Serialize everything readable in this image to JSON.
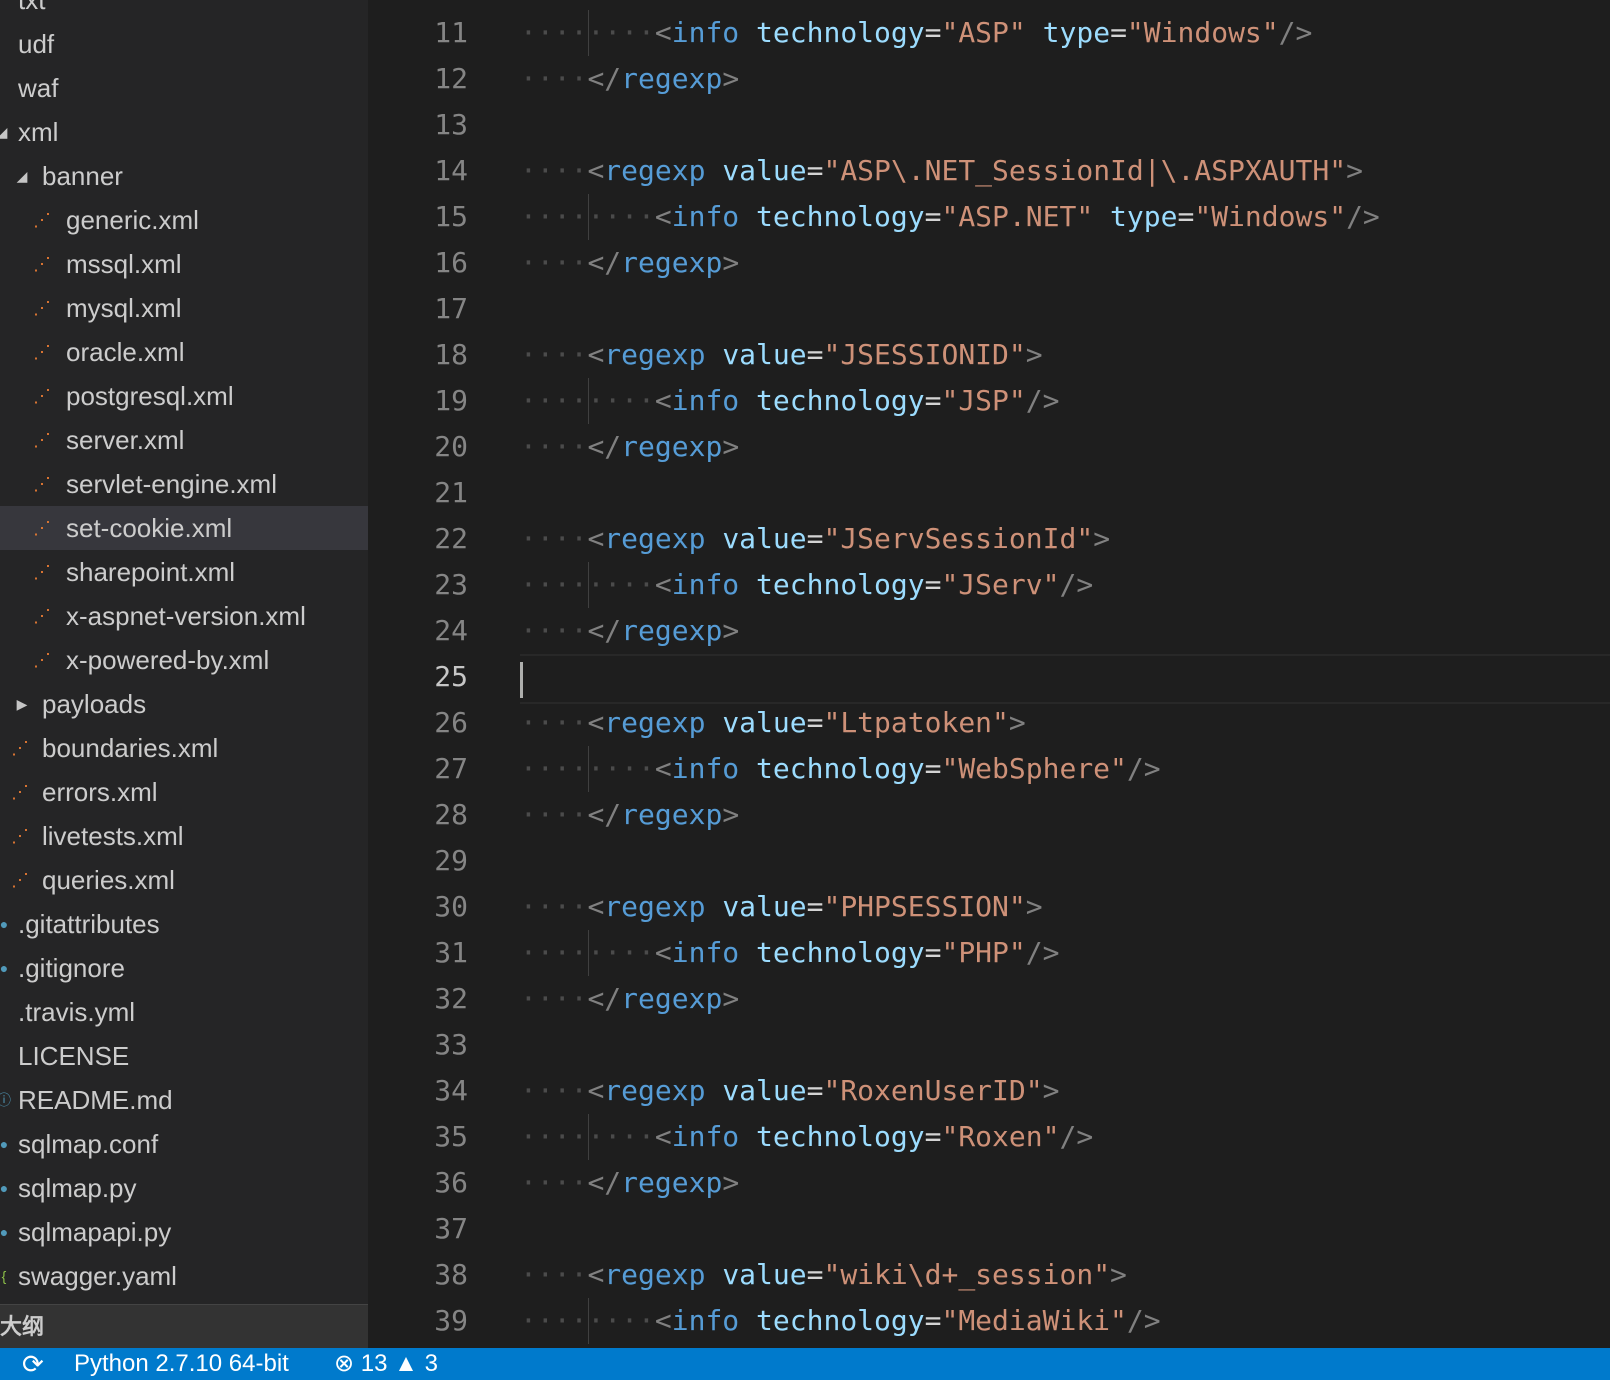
{
  "sidebar": {
    "tree": [
      {
        "label": "txt",
        "indent": 0,
        "icon": "none"
      },
      {
        "label": "udf",
        "indent": 0,
        "icon": "none"
      },
      {
        "label": "waf",
        "indent": 0,
        "icon": "none"
      },
      {
        "label": "xml",
        "indent": 0,
        "icon": "chevron-down"
      },
      {
        "label": "banner",
        "indent": 1,
        "icon": "chevron-down"
      },
      {
        "label": "generic.xml",
        "indent": 2,
        "icon": "rss"
      },
      {
        "label": "mssql.xml",
        "indent": 2,
        "icon": "rss"
      },
      {
        "label": "mysql.xml",
        "indent": 2,
        "icon": "rss"
      },
      {
        "label": "oracle.xml",
        "indent": 2,
        "icon": "rss"
      },
      {
        "label": "postgresql.xml",
        "indent": 2,
        "icon": "rss"
      },
      {
        "label": "server.xml",
        "indent": 2,
        "icon": "rss"
      },
      {
        "label": "servlet-engine.xml",
        "indent": 2,
        "icon": "rss"
      },
      {
        "label": "set-cookie.xml",
        "indent": 2,
        "icon": "rss",
        "selected": true
      },
      {
        "label": "sharepoint.xml",
        "indent": 2,
        "icon": "rss"
      },
      {
        "label": "x-aspnet-version.xml",
        "indent": 2,
        "icon": "rss"
      },
      {
        "label": "x-powered-by.xml",
        "indent": 2,
        "icon": "rss"
      },
      {
        "label": "payloads",
        "indent": 1,
        "icon": "chevron-right"
      },
      {
        "label": "boundaries.xml",
        "indent": 1,
        "icon": "rss"
      },
      {
        "label": "errors.xml",
        "indent": 1,
        "icon": "rss"
      },
      {
        "label": "livetests.xml",
        "indent": 1,
        "icon": "rss"
      },
      {
        "label": "queries.xml",
        "indent": 1,
        "icon": "rss"
      },
      {
        "label": ".gitattributes",
        "indent": 0,
        "icon": "dot"
      },
      {
        "label": ".gitignore",
        "indent": 0,
        "icon": "dot"
      },
      {
        "label": ".travis.yml",
        "indent": 0,
        "icon": "none"
      },
      {
        "label": "LICENSE",
        "indent": 0,
        "icon": "none"
      },
      {
        "label": "README.md",
        "indent": 0,
        "icon": "info"
      },
      {
        "label": "sqlmap.conf",
        "indent": 0,
        "icon": "dot"
      },
      {
        "label": "sqlmap.py",
        "indent": 0,
        "icon": "dot"
      },
      {
        "label": "sqlmapapi.py",
        "indent": 0,
        "icon": "dot"
      },
      {
        "label": "swagger.yaml",
        "indent": 0,
        "icon": "bracket"
      }
    ],
    "outline_label": "大纲"
  },
  "editor": {
    "active_line": 25,
    "lines": [
      {
        "n": "11",
        "kind": "info",
        "tech": "ASP",
        "type": "Windows"
      },
      {
        "n": "12",
        "kind": "close"
      },
      {
        "n": "13",
        "kind": "blank"
      },
      {
        "n": "14",
        "kind": "open",
        "value": "ASP\\.NET_SessionId|\\.ASPXAUTH"
      },
      {
        "n": "15",
        "kind": "info",
        "tech": "ASP.NET",
        "type": "Windows"
      },
      {
        "n": "16",
        "kind": "close"
      },
      {
        "n": "17",
        "kind": "blank"
      },
      {
        "n": "18",
        "kind": "open",
        "value": "JSESSIONID"
      },
      {
        "n": "19",
        "kind": "info",
        "tech": "JSP"
      },
      {
        "n": "20",
        "kind": "close"
      },
      {
        "n": "21",
        "kind": "blank"
      },
      {
        "n": "22",
        "kind": "open",
        "value": "JServSessionId"
      },
      {
        "n": "23",
        "kind": "info",
        "tech": "JServ"
      },
      {
        "n": "24",
        "kind": "close"
      },
      {
        "n": "25",
        "kind": "blank"
      },
      {
        "n": "26",
        "kind": "open",
        "value": "Ltpatoken"
      },
      {
        "n": "27",
        "kind": "info",
        "tech": "WebSphere"
      },
      {
        "n": "28",
        "kind": "close"
      },
      {
        "n": "29",
        "kind": "blank"
      },
      {
        "n": "30",
        "kind": "open",
        "value": "PHPSESSION"
      },
      {
        "n": "31",
        "kind": "info",
        "tech": "PHP"
      },
      {
        "n": "32",
        "kind": "close"
      },
      {
        "n": "33",
        "kind": "blank"
      },
      {
        "n": "34",
        "kind": "open",
        "value": "RoxenUserID"
      },
      {
        "n": "35",
        "kind": "info",
        "tech": "Roxen"
      },
      {
        "n": "36",
        "kind": "close"
      },
      {
        "n": "37",
        "kind": "blank"
      },
      {
        "n": "38",
        "kind": "open",
        "value": "wiki\\d+_session"
      },
      {
        "n": "39",
        "kind": "info",
        "tech": "MediaWiki"
      }
    ],
    "tokens": {
      "regexp": "regexp",
      "info": "info",
      "value_attr": "value",
      "technology_attr": "technology",
      "type_attr": "type"
    }
  },
  "statusbar": {
    "interpreter": "Python 2.7.10 64-bit",
    "errors": "13",
    "warnings": "3"
  },
  "colors": {
    "tag": "#569cd6",
    "attribute": "#9cdcfe",
    "string": "#ce9178",
    "status_bar": "#007acc",
    "xml_icon": "#e37933"
  }
}
